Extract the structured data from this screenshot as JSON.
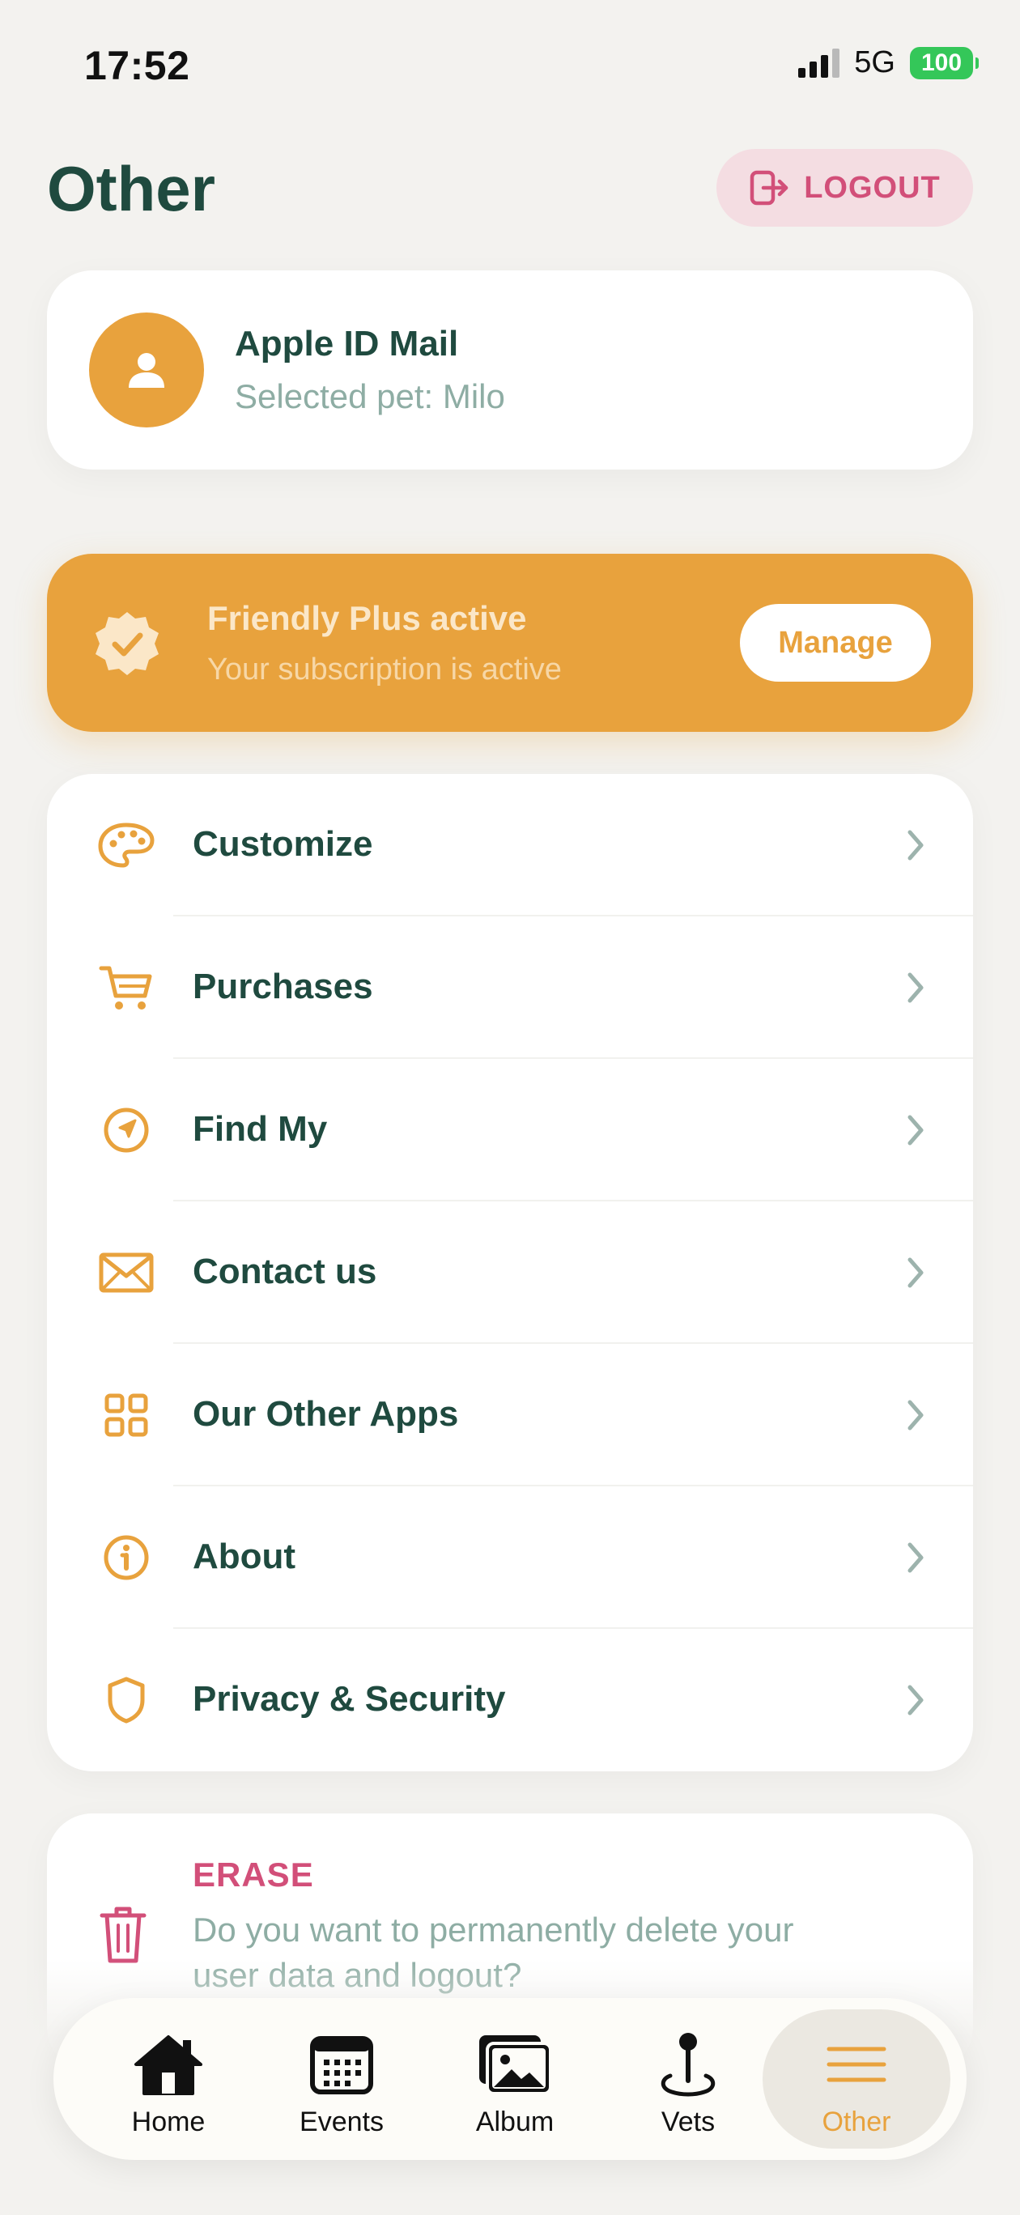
{
  "status_bar": {
    "time": "17:52",
    "network": "5G",
    "battery": "100"
  },
  "header": {
    "title": "Other",
    "logout_label": "LOGOUT"
  },
  "profile": {
    "name": "Apple ID Mail",
    "subtitle": "Selected pet: Milo"
  },
  "subscription": {
    "title": "Friendly Plus active",
    "text": "Your subscription is active",
    "manage_label": "Manage"
  },
  "menu": {
    "items": [
      {
        "label": "Customize",
        "icon": "palette-icon"
      },
      {
        "label": "Purchases",
        "icon": "cart-icon"
      },
      {
        "label": "Find My",
        "icon": "location-arrow-icon"
      },
      {
        "label": "Contact us",
        "icon": "envelope-icon"
      },
      {
        "label": "Our Other Apps",
        "icon": "grid-icon"
      },
      {
        "label": "About",
        "icon": "info-icon"
      },
      {
        "label": "Privacy & Security",
        "icon": "shield-icon"
      }
    ]
  },
  "erase": {
    "title": "ERASE",
    "text": "Do you want to permanently delete your user data and logout?"
  },
  "tabs": [
    {
      "label": "Home",
      "icon": "home-icon"
    },
    {
      "label": "Events",
      "icon": "calendar-icon"
    },
    {
      "label": "Album",
      "icon": "photos-icon"
    },
    {
      "label": "Vets",
      "icon": "map-pin-icon"
    },
    {
      "label": "Other",
      "icon": "menu-icon",
      "active": true
    }
  ],
  "colors": {
    "accent": "#e8a23d",
    "text_primary": "#1f4a3f",
    "text_secondary": "#8eada4",
    "danger": "#d24f79",
    "background": "#f3f2ef"
  }
}
